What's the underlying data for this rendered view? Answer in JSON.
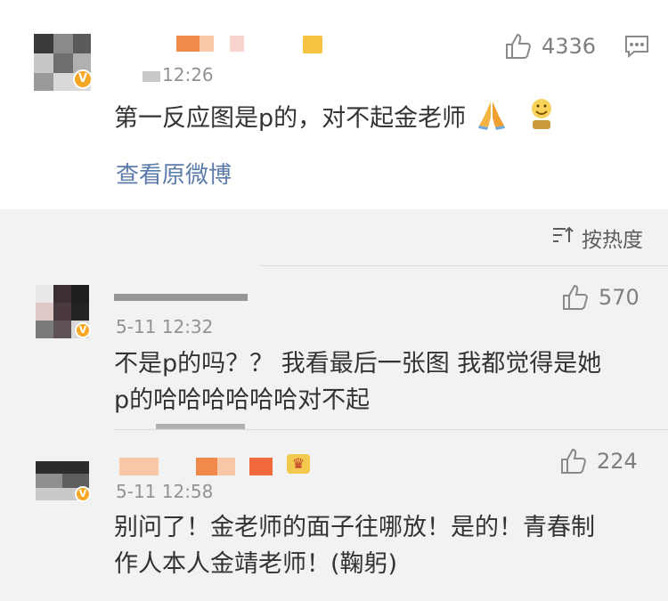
{
  "main_comment": {
    "time": "12:26",
    "likes": "4336",
    "text": "第一反应图是p的，对不起金老师",
    "link": "查看原微博"
  },
  "sort": {
    "label": "按热度"
  },
  "replies": [
    {
      "time": "5-11 12:32",
      "likes": "570",
      "text_line1": "不是p的吗？？ 我看最后一张图 我都觉得是她",
      "text_line2": "p的哈哈哈哈哈哈对不起"
    },
    {
      "time": "5-11 12:58",
      "likes": "224",
      "text_line1": "别问了！金老师的面子往哪放！是的！青春制",
      "text_line2": "作人本人金靖老师！(鞠躬)"
    }
  ],
  "colors": {
    "link": "#5b7caa",
    "verified_badge": "#f5a623",
    "meta_gray": "#939393"
  },
  "icons": {
    "like": "thumbs-up-icon",
    "comment": "comment-icon",
    "sort": "sort-icon",
    "pray": "folded-hands-emoji",
    "grin": "grinning-emoji",
    "crown": "crown-badge-icon",
    "verified": "verified-v-badge"
  }
}
